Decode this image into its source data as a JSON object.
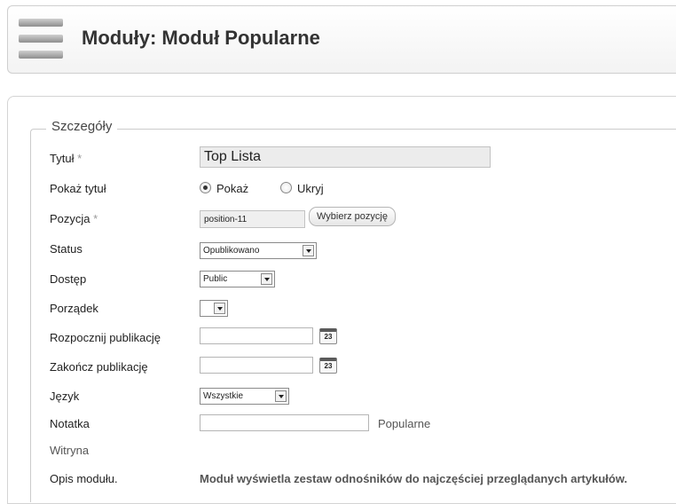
{
  "header": {
    "title": "Moduły: Moduł Popularne",
    "icon": "menu-icon"
  },
  "details": {
    "legend": "Szczegóły",
    "required_mark": "*",
    "title_label": "Tytuł",
    "title_value": "Top Lista",
    "show_title_label": "Pokaż tytuł",
    "show_title_options": [
      "Pokaż",
      "Ukryj"
    ],
    "show_title_selected": "Pokaż",
    "position_label": "Pozycja",
    "position_value": "position-11",
    "choose_position_button": "Wybierz pozycję",
    "status_label": "Status",
    "status_value": "Opublikowano",
    "access_label": "Dostęp",
    "access_value": "Public",
    "ordering_label": "Porządek",
    "ordering_value": "",
    "publish_up_label": "Rozpocznij publikację",
    "publish_down_label": "Zakończ publikację",
    "calendar_day": "23",
    "language_label": "Język",
    "language_value": "Wszystkie",
    "note_label": "Notatka",
    "note_value": "",
    "module_name": "Popularne",
    "site_label": "Witryna",
    "description_label": "Opis modułu.",
    "description_text": "Moduł wyświetla zestaw odnośników do najczęściej przeglądanych artykułów."
  }
}
